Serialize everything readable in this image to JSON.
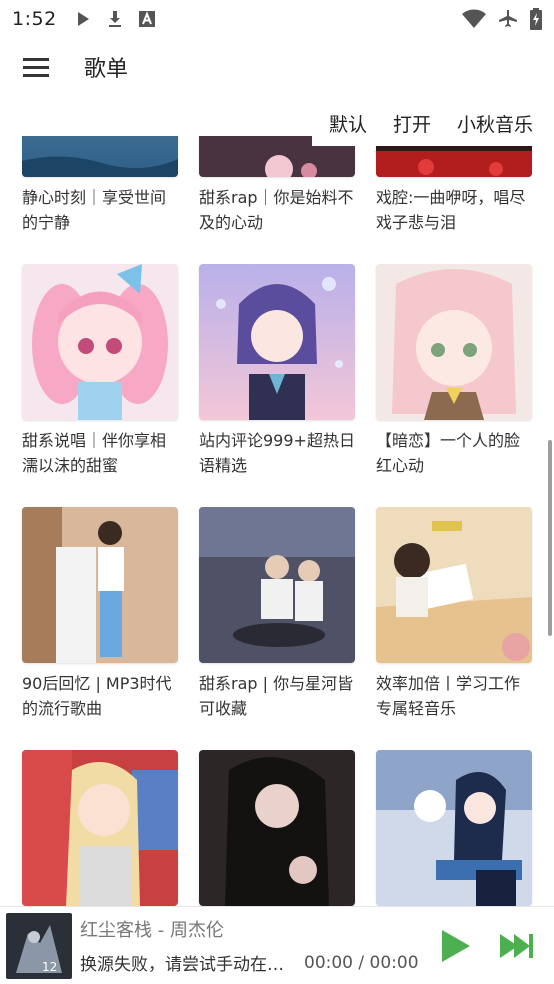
{
  "status_bar": {
    "time": "1:52",
    "icons_left": [
      "play-icon",
      "download-icon",
      "font-a-icon"
    ],
    "icons_right": [
      "wifi-icon",
      "airplane-icon",
      "battery-charging-icon"
    ]
  },
  "app_bar": {
    "title": "歌单",
    "menu_icon": "hamburger-menu-icon"
  },
  "actions": {
    "default_label": "默认",
    "open_label": "打开",
    "source_label": "小秋音乐"
  },
  "playlists": [
    {
      "title": "静心时刻｜享受世间的宁静"
    },
    {
      "title": "甜系rap｜你是始料不及的心动"
    },
    {
      "title": "戏腔:一曲咿呀，唱尽戏子悲与泪"
    },
    {
      "title": "甜系说唱｜伴你享相濡以沫的甜蜜"
    },
    {
      "title": "站内评论999+超热日语精选"
    },
    {
      "title": "【暗恋】一个人的脸红心动"
    },
    {
      "title": "90后回忆 | MP3时代的流行歌曲"
    },
    {
      "title": "甜系rap | 你与星河皆可收藏"
    },
    {
      "title": "效率加倍丨学习工作专属轻音乐"
    },
    {
      "title": ""
    },
    {
      "title": ""
    },
    {
      "title": ""
    }
  ],
  "player": {
    "song": "红尘客栈 - 周杰伦",
    "status": "换源失败，请尝试手动在搜...",
    "time": "00:00 / 00:00",
    "art_caption": "12",
    "accent_color": "#4caf50"
  }
}
